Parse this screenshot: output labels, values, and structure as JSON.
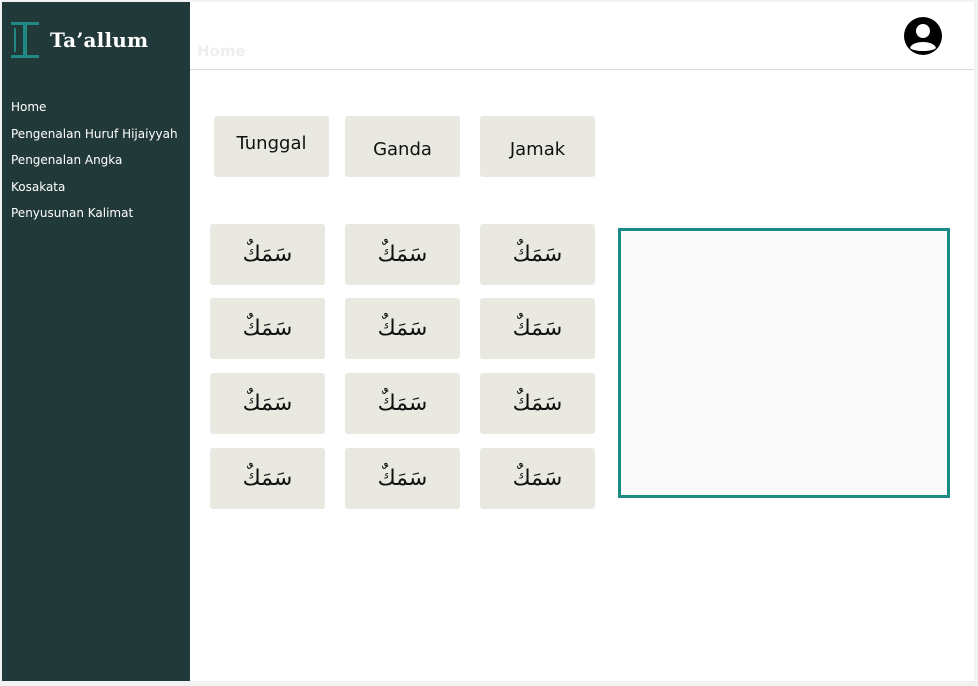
{
  "app": {
    "name": "Ta’allum"
  },
  "topbar": {
    "ghost_text": "Home"
  },
  "sidebar": {
    "items": [
      {
        "label": "Home"
      },
      {
        "label": "Pengenalan Huruf Hijaiyyah"
      },
      {
        "label": "Pengenalan Angka"
      },
      {
        "label": "Kosakata"
      },
      {
        "label": "Penyusunan Kalimat"
      }
    ]
  },
  "categories": [
    {
      "label": "Tunggal"
    },
    {
      "label": "Ganda"
    },
    {
      "label": "Jamak"
    }
  ],
  "words": [
    {
      "text": "سَمَكٌ"
    },
    {
      "text": "سَمَكٌ"
    },
    {
      "text": "سَمَكٌ"
    },
    {
      "text": "سَمَكٌ"
    },
    {
      "text": "سَمَكٌ"
    },
    {
      "text": "سَمَكٌ"
    },
    {
      "text": "سَمَكٌ"
    },
    {
      "text": "سَمَكٌ"
    },
    {
      "text": "سَمَكٌ"
    },
    {
      "text": "سَمَكٌ"
    },
    {
      "text": "سَمَكٌ"
    },
    {
      "text": "سَمَكٌ"
    }
  ],
  "colors": {
    "sidebar": "#22393a",
    "accent": "#1a8a85",
    "card": "#e9e8e1"
  },
  "icons": {
    "profile": "user-avatar-icon",
    "logo": "logo-mark-icon"
  }
}
